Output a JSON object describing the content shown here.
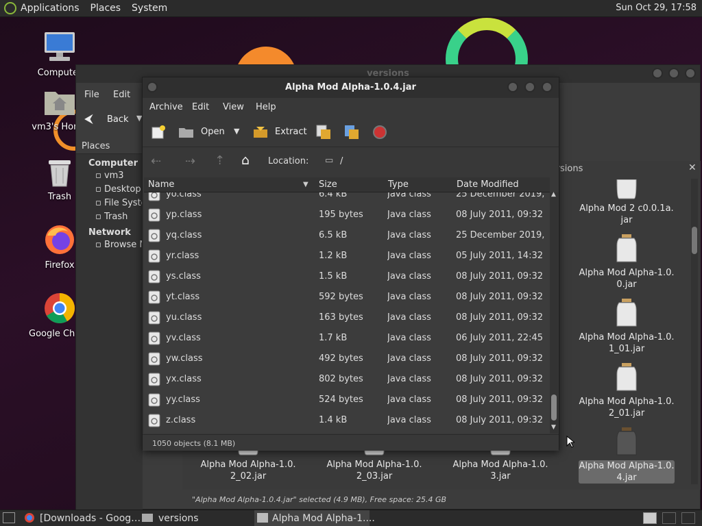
{
  "top_panel": {
    "menus": [
      "Applications",
      "Places",
      "System"
    ],
    "clock": "Sun Oct 29, 17:58"
  },
  "desktop": {
    "icons": [
      {
        "label": "Computer",
        "icon": "computer-icon"
      },
      {
        "label": "vm3's Home",
        "icon": "home-folder-icon"
      },
      {
        "label": "Trash",
        "icon": "trash-icon"
      },
      {
        "label": "Firefox",
        "icon": "firefox-icon"
      },
      {
        "label": "Google Chrome",
        "icon": "chrome-icon"
      }
    ]
  },
  "file_manager": {
    "title": "versions",
    "menu": [
      "File",
      "Edit"
    ],
    "back_label": "Back",
    "tab_label": "versions",
    "places_header": "Places",
    "places": {
      "computer_label": "Computer",
      "computer_items": [
        "vm3",
        "Desktop",
        "File System",
        "Trash"
      ],
      "network_label": "Network",
      "network_items": [
        "Browse Network"
      ]
    },
    "files": [
      {
        "name": "Alpha Mod 2 c0.0.1a.jar",
        "lines": [
          "Alpha Mod 2 c0.0.1a.",
          "jar"
        ],
        "selected": false
      },
      {
        "name": "Alpha Mod Alpha-1.0.0.jar",
        "lines": [
          "Alpha Mod Alpha-1.0.",
          "0.jar"
        ],
        "selected": false
      },
      {
        "name": "Alpha Mod Alpha-1.0.1_01.jar",
        "lines": [
          "Alpha Mod Alpha-1.0.",
          "1_01.jar"
        ],
        "selected": false
      },
      {
        "name": "Alpha Mod Alpha-1.0.2_01.jar",
        "lines": [
          "Alpha Mod Alpha-1.0.",
          "2_01.jar"
        ],
        "selected": false
      },
      {
        "name": "Alpha Mod Alpha-1.0.2_02.jar",
        "lines": [
          "Alpha Mod Alpha-1.0.",
          "2_02.jar"
        ],
        "selected": false
      },
      {
        "name": "Alpha Mod Alpha-1.0.2_03.jar",
        "lines": [
          "Alpha Mod Alpha-1.0.",
          "2_03.jar"
        ],
        "selected": false
      },
      {
        "name": "Alpha Mod Alpha-1.0.3.jar",
        "lines": [
          "Alpha Mod Alpha-1.0.",
          "3.jar"
        ],
        "selected": false
      },
      {
        "name": "Alpha Mod Alpha-1.0.4.jar",
        "lines": [
          "Alpha Mod Alpha-1.0.",
          "4.jar"
        ],
        "selected": true
      }
    ],
    "status": "\"Alpha Mod Alpha-1.0.4.jar\" selected (4.9 MB), Free space: 25.4 GB"
  },
  "archive": {
    "title": "Alpha Mod Alpha-1.0.4.jar",
    "menu": [
      "Archive",
      "Edit",
      "View",
      "Help"
    ],
    "toolbar": {
      "open_label": "Open",
      "extract_label": "Extract"
    },
    "location_label": "Location:",
    "location_value": "/",
    "columns": [
      "Name",
      "Size",
      "Type",
      "Date Modified"
    ],
    "rows": [
      {
        "name": "yo.class",
        "size": "6.4 kB",
        "type": "Java class",
        "date": "25 December 2019, …"
      },
      {
        "name": "yp.class",
        "size": "195 bytes",
        "type": "Java class",
        "date": "08 July 2011, 09:32"
      },
      {
        "name": "yq.class",
        "size": "6.5 kB",
        "type": "Java class",
        "date": "25 December 2019, …"
      },
      {
        "name": "yr.class",
        "size": "1.2 kB",
        "type": "Java class",
        "date": "05 July 2011, 14:32"
      },
      {
        "name": "ys.class",
        "size": "1.5 kB",
        "type": "Java class",
        "date": "08 July 2011, 09:32"
      },
      {
        "name": "yt.class",
        "size": "592 bytes",
        "type": "Java class",
        "date": "08 July 2011, 09:32"
      },
      {
        "name": "yu.class",
        "size": "163 bytes",
        "type": "Java class",
        "date": "08 July 2011, 09:32"
      },
      {
        "name": "yv.class",
        "size": "1.7 kB",
        "type": "Java class",
        "date": "06 July 2011, 22:45"
      },
      {
        "name": "yw.class",
        "size": "492 bytes",
        "type": "Java class",
        "date": "08 July 2011, 09:32"
      },
      {
        "name": "yx.class",
        "size": "802 bytes",
        "type": "Java class",
        "date": "08 July 2011, 09:32"
      },
      {
        "name": "yy.class",
        "size": "524 bytes",
        "type": "Java class",
        "date": "08 July 2011, 09:32"
      },
      {
        "name": "z.class",
        "size": "1.4 kB",
        "type": "Java class",
        "date": "08 July 2011, 09:32"
      }
    ],
    "status": "1050 objects (8.1 MB)"
  },
  "taskbar": {
    "tasks": [
      {
        "label": "[Downloads - Goog…",
        "icon": "chrome-icon"
      },
      {
        "label": "versions",
        "icon": "folder-icon"
      },
      {
        "label": "Alpha Mod Alpha-1....",
        "icon": "archive-icon"
      }
    ]
  }
}
